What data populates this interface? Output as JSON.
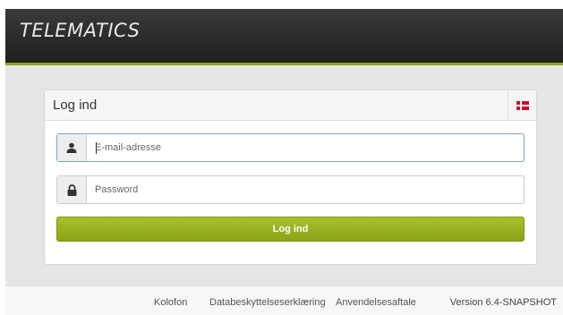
{
  "header": {
    "logo_text": "TELEMATICS"
  },
  "login_panel": {
    "title": "Log ind",
    "language_flag": "denmark-flag-icon",
    "email": {
      "icon": "user-icon",
      "placeholder": "E-mail-adresse",
      "value": ""
    },
    "password": {
      "icon": "lock-icon",
      "placeholder": "Password",
      "value": ""
    },
    "submit_label": "Log ind"
  },
  "footer": {
    "links": [
      "Kolofon",
      "Databeskyttelseserklæring",
      "Anvendelsesaftale"
    ],
    "version": "Version 6.4-SNAPSHOT"
  },
  "colors": {
    "header_bg": "#262626",
    "accent_green": "#8fa519",
    "content_bg": "#e6e6e6",
    "flag_red": "#c8102e"
  }
}
